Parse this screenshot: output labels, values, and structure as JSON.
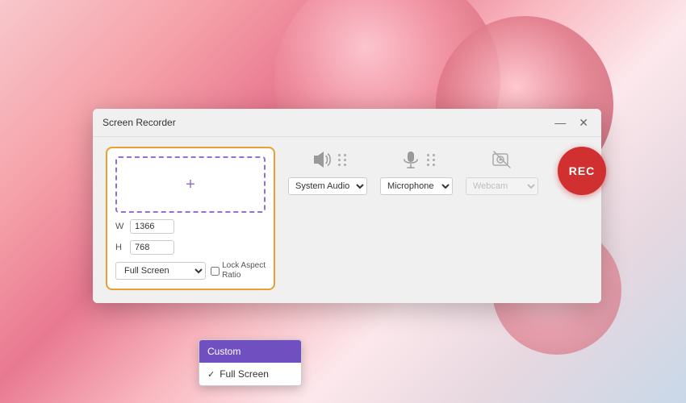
{
  "background": {
    "description": "Floral background with pink flowers"
  },
  "window": {
    "title": "Screen Recorder",
    "controls": {
      "minimize": "—",
      "close": "✕"
    }
  },
  "screen_area": {
    "width_label": "W",
    "height_label": "H",
    "width_value": "1366",
    "height_value": "768",
    "dropdown_value": "Full Screen",
    "lock_label": "Lock Aspect\nRatio",
    "dropdown_options": [
      {
        "label": "Custom",
        "selected": true
      },
      {
        "label": "Full Screen",
        "selected": false,
        "checked": true
      }
    ]
  },
  "audio_video": {
    "system_audio": {
      "label": "System Audio",
      "icon": "speaker"
    },
    "microphone": {
      "label": "Microphone",
      "icon": "microphone"
    },
    "webcam": {
      "label": "Webcam",
      "icon": "webcam"
    }
  },
  "rec_button": {
    "label": "REC"
  }
}
